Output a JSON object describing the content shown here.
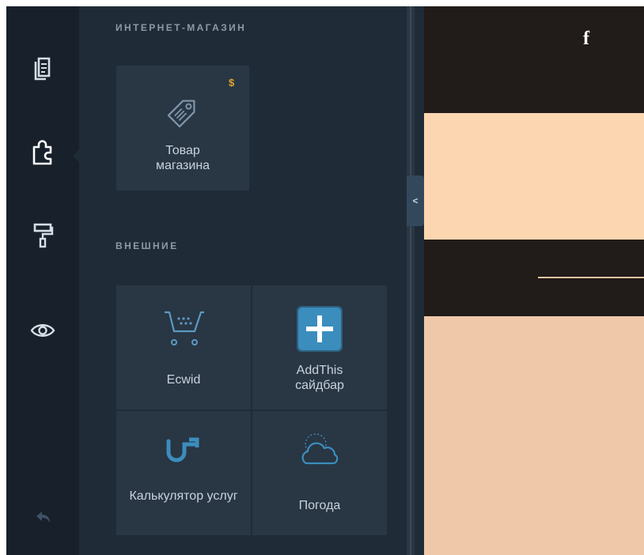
{
  "rail": {
    "items": [
      {
        "name": "pages",
        "icon": "pages-icon",
        "active": false
      },
      {
        "name": "add-elements",
        "icon": "puzzle-icon",
        "active": true
      },
      {
        "name": "design",
        "icon": "paint-roller-icon",
        "active": false
      },
      {
        "name": "preview",
        "icon": "eye-icon",
        "active": false
      }
    ],
    "undo_icon": "undo-icon"
  },
  "panel": {
    "sections": [
      {
        "title": "ИНТЕРНЕТ-МАГАЗИН",
        "tiles": [
          {
            "label": "Товар магазина",
            "icon": "price-tag-icon",
            "badge": "$"
          }
        ]
      },
      {
        "title": "ВНЕШНИЕ",
        "tiles": [
          {
            "label": "Ecwid",
            "icon": "shopping-cart-icon"
          },
          {
            "label": "AddThis сайдбар",
            "icon": "addthis-plus-icon"
          },
          {
            "label": "Калькулятор услуг",
            "icon": "calculator-logo-icon"
          },
          {
            "label": "Погода",
            "icon": "weather-cloud-icon"
          }
        ]
      }
    ],
    "collapse_label": "<"
  },
  "preview": {
    "social_label": "f"
  },
  "colors": {
    "rail_bg": "#17202b",
    "panel_bg": "#1f2b37",
    "tile_bg": "#293644",
    "accent_blue": "#3b8dbd",
    "badge_gold": "#e0a62c",
    "preview_dark": "#211c19",
    "preview_peach": "#fcd6b1"
  }
}
